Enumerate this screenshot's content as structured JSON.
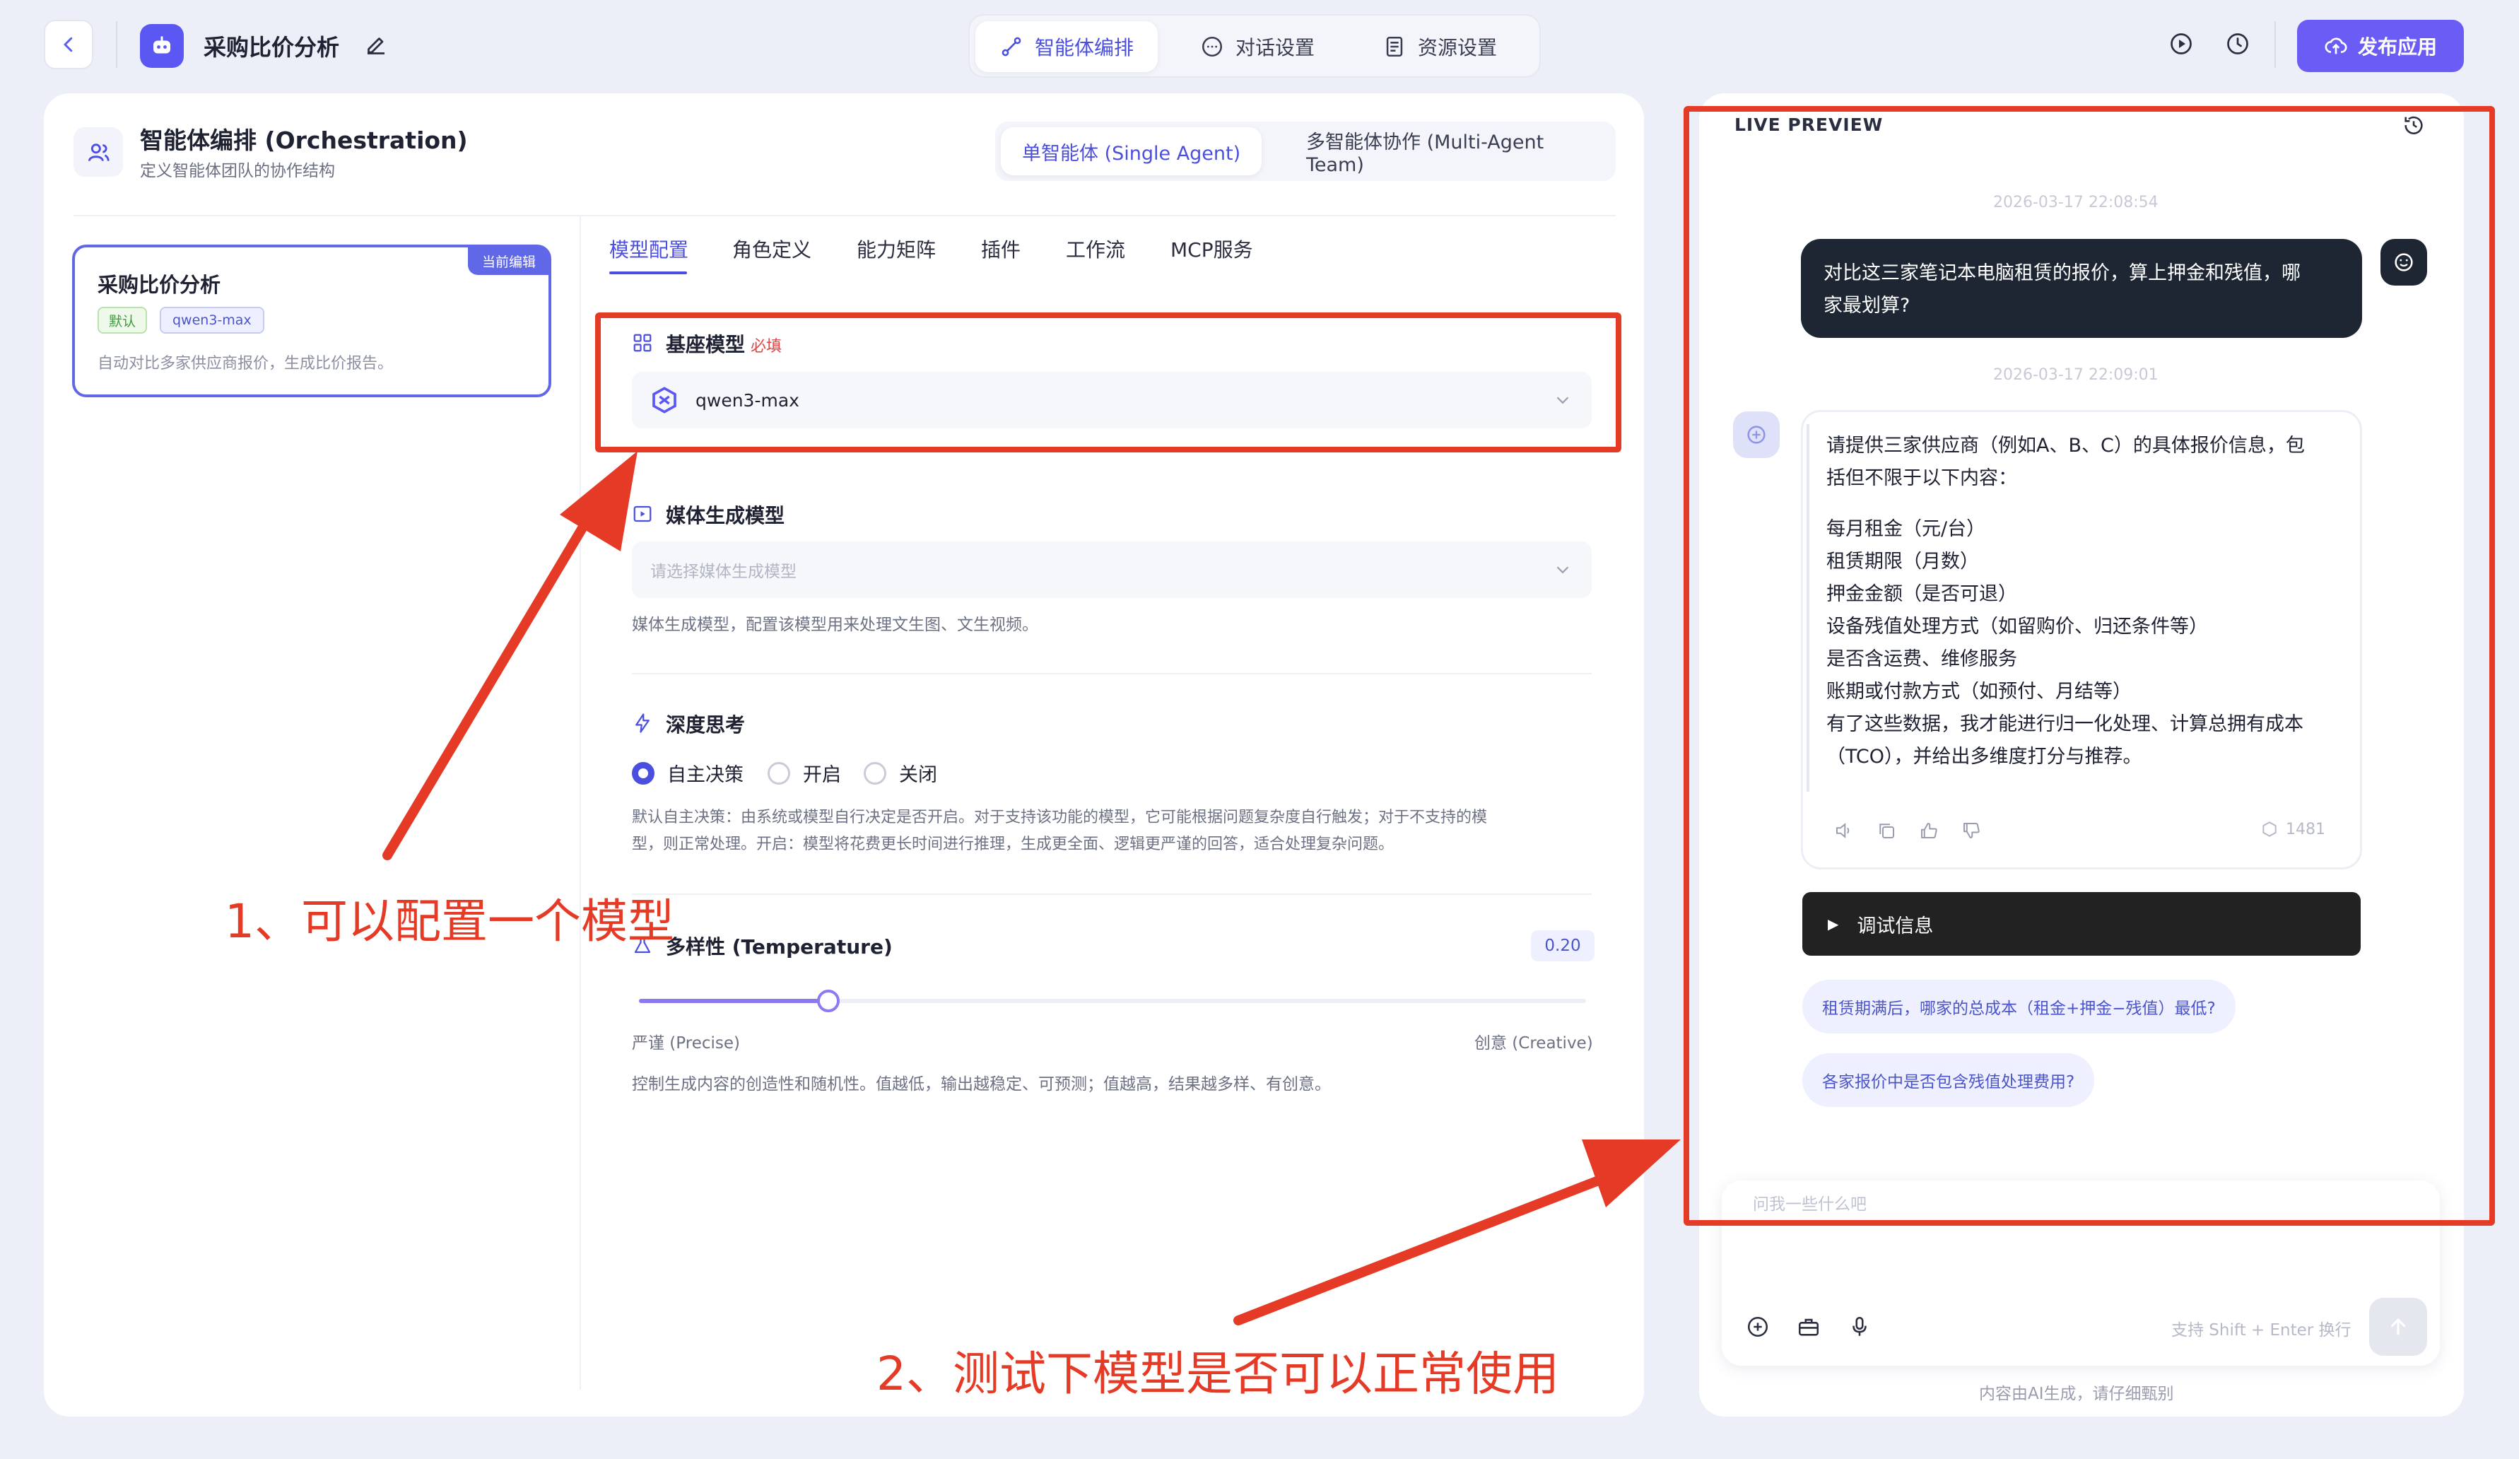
{
  "topbar": {
    "app_title": "采购比价分析",
    "tabs": [
      {
        "label": "智能体编排",
        "active": true
      },
      {
        "label": "对话设置",
        "active": false
      },
      {
        "label": "资源设置",
        "active": false
      }
    ],
    "publish_label": "发布应用"
  },
  "orchestration": {
    "title": "智能体编排 (Orchestration)",
    "subtitle": "定义智能体团队的协作结构",
    "mode_single": "单智能体 (Single Agent)",
    "mode_multi": "多智能体协作 (Multi-Agent Team)"
  },
  "agent_card": {
    "badge": "当前编辑",
    "title": "采购比价分析",
    "tag_default": "默认",
    "tag_model": "qwen3-max",
    "description": "自动对比多家供应商报价，生成比价报告。"
  },
  "config_tabs": [
    "模型配置",
    "角色定义",
    "能力矩阵",
    "插件",
    "工作流",
    "MCP服务"
  ],
  "base_model": {
    "title": "基座模型",
    "required": "必填",
    "value": "qwen3-max"
  },
  "media_model": {
    "title": "媒体生成模型",
    "placeholder": "请选择媒体生成模型",
    "help": "媒体生成模型，配置该模型用来处理文生图、文生视频。"
  },
  "deep_thinking": {
    "title": "深度思考",
    "options": [
      "自主决策",
      "开启",
      "关闭"
    ],
    "selected": "自主决策",
    "help_line1": "默认自主决策：由系统或模型自行决定是否开启。对于支持该功能的模型，它可能根据问题复杂度自行触发；对于不支持的模",
    "help_line2": "型，则正常处理。开启：模型将花费更长时间进行推理，生成更全面、逻辑更严谨的回答，适合处理复杂问题。"
  },
  "temperature": {
    "title": "多样性 (Temperature)",
    "value": "0.20",
    "fraction": 0.2,
    "left_label": "严谨 (Precise)",
    "right_label": "创意 (Creative)",
    "help": "控制生成内容的创造性和随机性。值越低，输出越稳定、可预测；值越高，结果越多样、有创意。"
  },
  "preview": {
    "title": "LIVE PREVIEW",
    "ts1": "2026-03-17 22:08:54",
    "user_msg_line1": "对比这三家笔记本电脑租赁的报价，算上押金和残值，哪",
    "user_msg_line2": "家最划算?",
    "ts2": "2026-03-17 22:09:01",
    "bot_intro_line1": "请提供三家供应商（例如A、B、C）的具体报价信息，包",
    "bot_intro_line2": "括但不限于以下内容：",
    "bot_items": [
      "每月租金（元/台）",
      "租赁期限（月数）",
      "押金金额（是否可退）",
      "设备残值处理方式（如留购价、归还条件等）",
      "是否含运费、维修服务",
      "账期或付款方式（如预付、月结等）"
    ],
    "bot_outro_line1": "有了这些数据，我才能进行归一化处理、计算总拥有成本",
    "bot_outro_line2": "（TCO），并给出多维度打分与推荐。",
    "token_count": "1481",
    "debug_label": "调试信息",
    "suggestions": [
      "租赁期满后，哪家的总成本（租金+押金−残值）最低?",
      "各家报价中是否包含残值处理费用?"
    ],
    "input_placeholder": "问我一些什么吧",
    "shift_hint": "支持 Shift + Enter 换行",
    "ai_note": "内容由AI生成，请仔细甄别"
  },
  "annotations": {
    "note1": "1、可以配置一个模型",
    "note2": "2、测试下模型是否可以正常使用",
    "color": "#e53a26"
  },
  "colors": {
    "accent": "#4b4fe0",
    "publish": "#6b5cf6",
    "background": "#eceff8"
  }
}
